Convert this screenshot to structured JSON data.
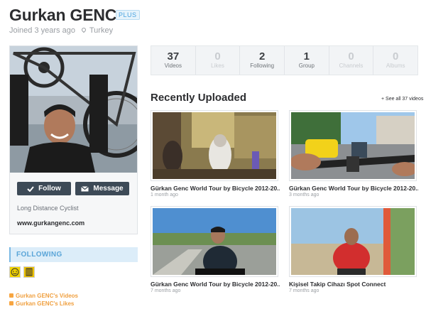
{
  "profile": {
    "name": "Gurkan GENC",
    "badge": "PLUS",
    "joined": "Joined 3 years ago",
    "location": "Turkey",
    "bio": "Long Distance Cyclist",
    "website": "www.gurkangenc.com"
  },
  "actions": {
    "follow": "Follow",
    "message": "Message"
  },
  "stats": [
    {
      "num": "37",
      "label": "Videos"
    },
    {
      "num": "0",
      "label": "Likes"
    },
    {
      "num": "2",
      "label": "Following"
    },
    {
      "num": "1",
      "label": "Group"
    },
    {
      "num": "0",
      "label": "Channels"
    },
    {
      "num": "0",
      "label": "Albums"
    }
  ],
  "recent": {
    "title": "Recently Uploaded",
    "see_all": "+ See all 37 videos",
    "videos": [
      {
        "title": "Gürkan Genc World Tour by Bicycle 2012-20...",
        "time": "1 month ago"
      },
      {
        "title": "Gürkan Genc World Tour by Bicycle 2012-20...",
        "time": "3 months ago"
      },
      {
        "title": "Gürkan Genc World Tour by Bicycle 2012-20...",
        "time": "7 months ago"
      },
      {
        "title": "Kişisel Takip Cihazı Spot Connect",
        "time": "7 months ago"
      }
    ]
  },
  "following": {
    "heading": "FOLLOWING"
  },
  "feeds": {
    "videos": "Gurkan GENC's Videos",
    "likes": "Gurkan GENC's Likes"
  },
  "icons": {
    "location": "map-pin-icon",
    "follow": "checkmark-icon",
    "message": "envelope-icon",
    "feed": "rss-icon"
  }
}
